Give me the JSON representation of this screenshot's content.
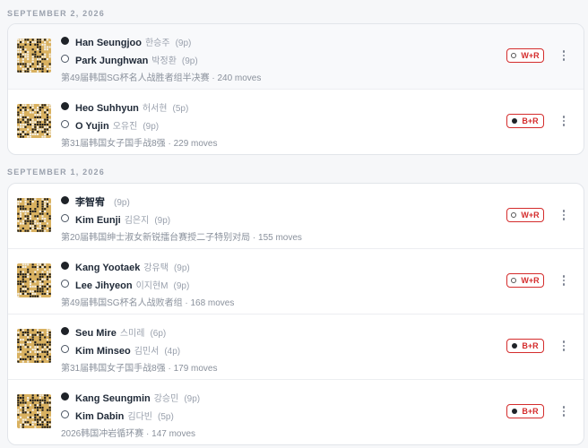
{
  "days": [
    {
      "label": "SEPTEMBER 2, 2026",
      "games": [
        {
          "black": {
            "name": "Han Seungjoo",
            "korean": "한승주",
            "rank": "(9p)"
          },
          "white": {
            "name": "Park Junghwan",
            "korean": "박정환",
            "rank": "(9p)"
          },
          "event": "第49届韩国SG杯名人战胜者组半决赛 · 240 moves",
          "result": "W+R",
          "winner": "white"
        },
        {
          "black": {
            "name": "Heo Suhhyun",
            "korean": "허서현",
            "rank": "(5p)"
          },
          "white": {
            "name": "O Yujin",
            "korean": "오유진",
            "rank": "(9p)"
          },
          "event": "第31届韩国女子国手战8强 · 229 moves",
          "result": "B+R",
          "winner": "black"
        }
      ]
    },
    {
      "label": "SEPTEMBER 1, 2026",
      "games": [
        {
          "black": {
            "name": "李智宥",
            "korean": "",
            "rank": "(9p)"
          },
          "white": {
            "name": "Kim Eunji",
            "korean": "김은지",
            "rank": "(9p)"
          },
          "event": "第20届韩国绅士淑女新锐擂台赛授二子特别对局 · 155 moves",
          "result": "W+R",
          "winner": "white"
        },
        {
          "black": {
            "name": "Kang Yootaek",
            "korean": "강유택",
            "rank": "(9p)"
          },
          "white": {
            "name": "Lee Jihyeon",
            "korean": "이지현M",
            "rank": "(9p)"
          },
          "event": "第49届韩国SG杯名人战败者组 · 168 moves",
          "result": "W+R",
          "winner": "white"
        },
        {
          "black": {
            "name": "Seu Mire",
            "korean": "스미레",
            "rank": "(6p)"
          },
          "white": {
            "name": "Kim Minseo",
            "korean": "김민서",
            "rank": "(4p)"
          },
          "event": "第31届韩国女子国手战8强 · 179 moves",
          "result": "B+R",
          "winner": "black"
        },
        {
          "black": {
            "name": "Kang Seungmin",
            "korean": "강승민",
            "rank": "(9p)"
          },
          "white": {
            "name": "Kim Dabin",
            "korean": "김다빈",
            "rank": "(5p)"
          },
          "event": "2026韩国冲岩循环赛 · 147 moves",
          "result": "B+R",
          "winner": "black"
        }
      ]
    }
  ],
  "icons": {
    "thumbnail": "go-board-thumbnail-icon",
    "menu": "more-vertical-icon",
    "black": "black-stone-icon",
    "white": "white-stone-icon"
  },
  "colors": {
    "result_red": "#d42c2c",
    "board": "#d9b160"
  }
}
